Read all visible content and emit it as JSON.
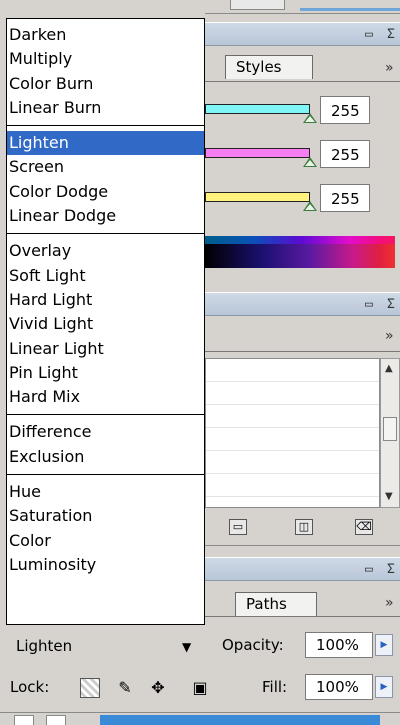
{
  "blend_menu": {
    "groups": [
      [
        "Darken",
        "Multiply",
        "Color Burn",
        "Linear Burn"
      ],
      [
        "Lighten",
        "Screen",
        "Color Dodge",
        "Linear Dodge"
      ],
      [
        "Overlay",
        "Soft Light",
        "Hard Light",
        "Vivid Light",
        "Linear Light",
        "Pin Light",
        "Hard Mix"
      ],
      [
        "Difference",
        "Exclusion"
      ],
      [
        "Hue",
        "Saturation",
        "Color",
        "Luminosity"
      ]
    ],
    "selected": "Lighten"
  },
  "color_panel": {
    "tab_styles": "Styles",
    "values": [
      "255",
      "255",
      "255"
    ],
    "slider_colors": [
      "#7ff5f5",
      "#f57ff0",
      "#fff27f"
    ]
  },
  "paths_panel": {
    "tab_paths": "Paths"
  },
  "layers_toolbar": {
    "blend_mode": "Lighten",
    "opacity_label": "Opacity:",
    "opacity_value": "100%",
    "lock_label": "Lock:",
    "fill_label": "Fill:",
    "fill_value": "100%"
  },
  "icons": [
    "minimize-icon",
    "close-icon",
    "panel-menu-icon",
    "folder-icon",
    "new-layer-icon",
    "trash-icon",
    "scroll-up-icon",
    "scroll-down-icon",
    "dropdown-arrow-icon",
    "lock-transparency-icon",
    "lock-image-icon",
    "lock-position-icon",
    "lock-all-icon"
  ],
  "colors": {
    "selection": "#3169c6",
    "panel": "#d6d3ce"
  }
}
